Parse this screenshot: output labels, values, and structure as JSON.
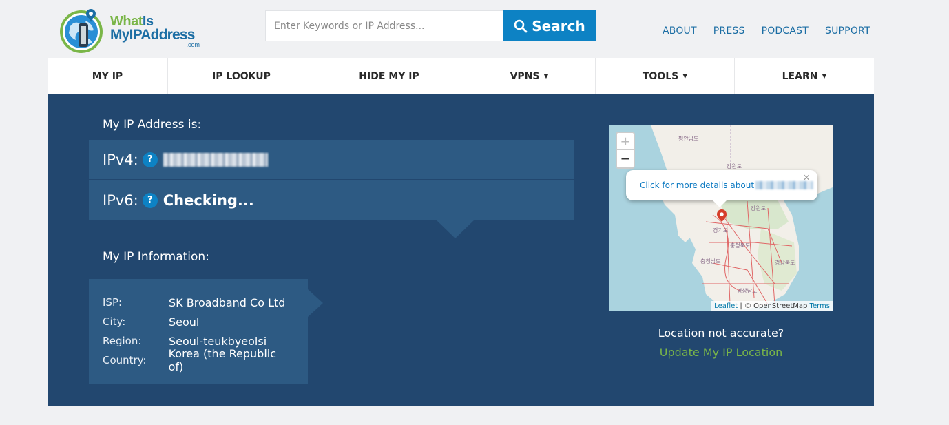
{
  "header": {
    "logo": {
      "line1a": "What",
      "line1b": "Is",
      "line2": "MyIPAddress",
      "line3": ".com"
    },
    "search": {
      "placeholder": "Enter Keywords or IP Address...",
      "button_label": "Search"
    },
    "topnav": [
      "ABOUT",
      "PRESS",
      "PODCAST",
      "SUPPORT"
    ]
  },
  "mainnav": [
    {
      "label": "MY IP",
      "dropdown": false
    },
    {
      "label": "IP LOOKUP",
      "dropdown": false
    },
    {
      "label": "HIDE MY IP",
      "dropdown": false
    },
    {
      "label": "VPNS",
      "dropdown": true
    },
    {
      "label": "TOOLS",
      "dropdown": true
    },
    {
      "label": "LEARN",
      "dropdown": true
    }
  ],
  "ip": {
    "heading": "My IP Address is:",
    "ipv4_label": "IPv4:",
    "ipv6_label": "IPv6:",
    "ipv6_value": "Checking...",
    "help": "?"
  },
  "info": {
    "heading": "My IP Information:",
    "rows": [
      {
        "key": "ISP:",
        "value": "SK Broadband Co Ltd"
      },
      {
        "key": "City:",
        "value": "Seoul"
      },
      {
        "key": "Region:",
        "value": "Seoul-teukbyeolsi"
      },
      {
        "key": "Country:",
        "value": "Korea (the Republic of)"
      }
    ]
  },
  "map": {
    "zoom_in": "+",
    "zoom_out": "−",
    "popup_text": "Click for more details about",
    "popup_close": "×",
    "attrib_leaflet": "Leaflet",
    "attrib_osm": "| © OpenStreetMap",
    "attrib_terms": "Terms",
    "labels": [
      "평안남도",
      "강원도",
      "강원도",
      "경기도",
      "충청북도",
      "충청남도",
      "경상북도",
      "경상남도"
    ]
  },
  "location": {
    "question": "Location not accurate?",
    "link": "Update My IP Location"
  },
  "colors": {
    "brand_blue": "#1c6ea4",
    "button_blue": "#0d82c4",
    "panel": "#22476f",
    "row": "#2d5a83",
    "green": "#7ab648"
  }
}
